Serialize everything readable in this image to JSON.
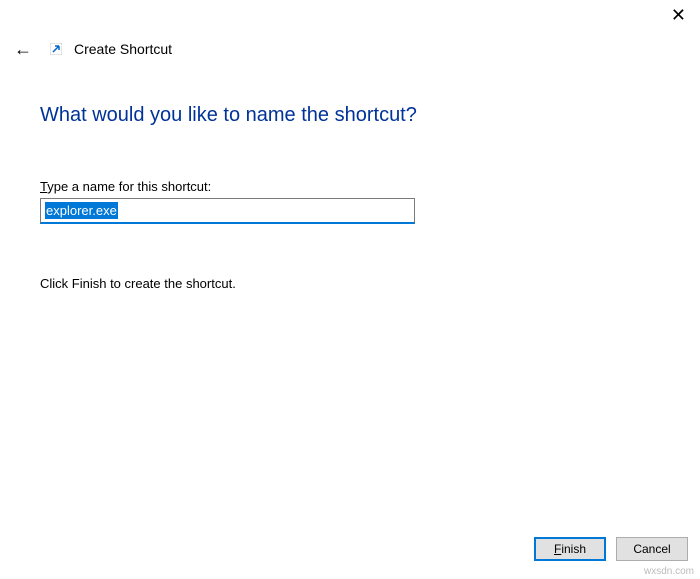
{
  "window": {
    "title": "Create Shortcut"
  },
  "page": {
    "heading": "What would you like to name the shortcut?",
    "field_label_prefix": "T",
    "field_label_rest": "ype a name for this shortcut:",
    "input_value": "explorer.exe",
    "instruction": "Click Finish to create the shortcut."
  },
  "buttons": {
    "finish_prefix": "F",
    "finish_rest": "inish",
    "cancel": "Cancel"
  },
  "watermark": "wxsdn.com"
}
